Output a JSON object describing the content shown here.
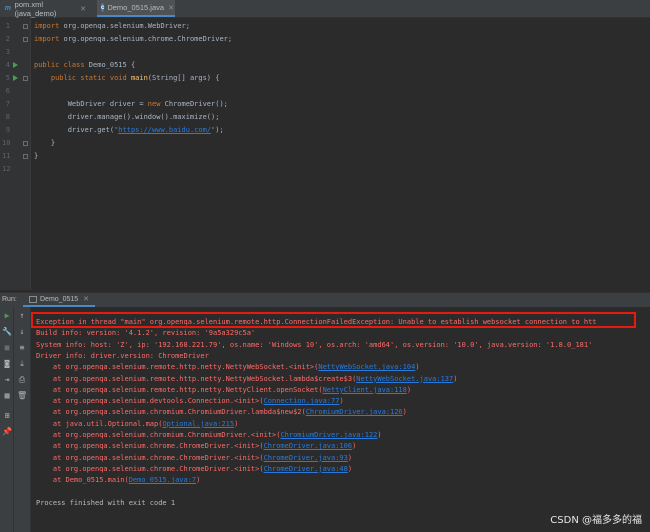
{
  "tabs": [
    {
      "label": "pom.xml (java_demo)",
      "icon": "maven-file-icon",
      "active": false
    },
    {
      "label": "Demo_0515.java",
      "icon": "java-class-icon",
      "active": true
    }
  ],
  "editor": {
    "line_numbers": [
      "1",
      "2",
      "3",
      "4",
      "5",
      "6",
      "7",
      "8",
      "9",
      "10",
      "11",
      "12"
    ],
    "code": [
      {
        "parts": [
          {
            "k": "kw",
            "t": "import "
          },
          {
            "k": "n",
            "t": "org.openqa.selenium.WebDriver;"
          }
        ]
      },
      {
        "parts": [
          {
            "k": "kw",
            "t": "import "
          },
          {
            "k": "n",
            "t": "org.openqa.selenium.chrome.ChromeDriver;"
          }
        ]
      },
      {
        "parts": []
      },
      {
        "parts": [
          {
            "k": "kw",
            "t": "public class "
          },
          {
            "k": "n",
            "t": "Demo_0515 {"
          }
        ]
      },
      {
        "parts": [
          {
            "k": "n",
            "t": "    "
          },
          {
            "k": "kw",
            "t": "public static void "
          },
          {
            "k": "fn",
            "t": "main"
          },
          {
            "k": "n",
            "t": "(String[] args) {"
          }
        ]
      },
      {
        "parts": []
      },
      {
        "parts": [
          {
            "k": "n",
            "t": "        WebDriver driver = "
          },
          {
            "k": "kw",
            "t": "new "
          },
          {
            "k": "n",
            "t": "ChromeDriver();"
          }
        ]
      },
      {
        "parts": [
          {
            "k": "n",
            "t": "        driver.manage().window().maximize();"
          }
        ]
      },
      {
        "parts": [
          {
            "k": "n",
            "t": "        driver.get("
          },
          {
            "k": "str",
            "t": "\""
          },
          {
            "k": "url",
            "t": "https://www.baidu.com/"
          },
          {
            "k": "str",
            "t": "\""
          },
          {
            "k": "n",
            "t": ");"
          }
        ]
      },
      {
        "parts": [
          {
            "k": "n",
            "t": "    }"
          }
        ]
      },
      {
        "parts": [
          {
            "k": "n",
            "t": "}"
          }
        ]
      },
      {
        "parts": []
      }
    ]
  },
  "run_panel": {
    "label": "Run:",
    "tab": "Demo_0515"
  },
  "console": {
    "lines": [
      {
        "style": "err",
        "text": "Exception in thread \"main\" org.openqa.selenium.remote.http.ConnectionFailedException: Unable to establish websocket connection to htt"
      },
      {
        "style": "err",
        "text": "Build info: version: '4.1.2', revision: '9a5a329c5a'"
      },
      {
        "style": "err",
        "text": "System info: host: 'Z', ip: '192.168.221.79', os.name: 'Windows 10', os.arch: 'amd64', os.version: '10.0', java.version: '1.8.0_181'"
      },
      {
        "style": "err",
        "text": "Driver info: driver.version: ChromeDriver"
      },
      {
        "style": "err",
        "text": "    at org.openqa.selenium.remote.http.netty.NettyWebSocket.<init>(",
        "link": "NettyWebSocket.java:104",
        "tail": ")"
      },
      {
        "style": "err",
        "text": "    at org.openqa.selenium.remote.http.netty.NettyWebSocket.lambda$create$3(",
        "link": "NettyWebSocket.java:137",
        "tail": ")"
      },
      {
        "style": "err",
        "text": "    at org.openqa.selenium.remote.http.netty.NettyClient.openSocket(",
        "link": "NettyClient.java:118",
        "tail": ")"
      },
      {
        "style": "err",
        "text": "    at org.openqa.selenium.devtools.Connection.<init>(",
        "link": "Connection.java:77",
        "tail": ")"
      },
      {
        "style": "err",
        "text": "    at org.openqa.selenium.chromium.ChromiumDriver.lambda$new$2(",
        "link": "ChromiumDriver.java:126",
        "tail": ")"
      },
      {
        "style": "err",
        "text": "    at java.util.Optional.map(",
        "link": "Optional.java:215",
        "tail": ")"
      },
      {
        "style": "err",
        "text": "    at org.openqa.selenium.chromium.ChromiumDriver.<init>(",
        "link": "ChromiumDriver.java:122",
        "tail": ")"
      },
      {
        "style": "err",
        "text": "    at org.openqa.selenium.chrome.ChromeDriver.<init>(",
        "link": "ChromeDriver.java:106",
        "tail": ")"
      },
      {
        "style": "err",
        "text": "    at org.openqa.selenium.chrome.ChromeDriver.<init>(",
        "link": "ChromeDriver.java:93",
        "tail": ")"
      },
      {
        "style": "err",
        "text": "    at org.openqa.selenium.chrome.ChromeDriver.<init>(",
        "link": "ChromeDriver.java:48",
        "tail": ")"
      },
      {
        "style": "err",
        "text": "    at Demo_0515.main(",
        "link": "Demo_0515.java:7",
        "tail": ")"
      },
      {
        "style": "plain",
        "text": ""
      },
      {
        "style": "plain",
        "text": "Process finished with exit code 1"
      }
    ]
  },
  "watermark": "CSDN @福多多的福",
  "colors": {
    "error": "#ff6b68",
    "link": "#287bde",
    "highlight_box": "#e8190d",
    "keyword": "#cc7832",
    "string": "#6a8759",
    "method": "#ffc66d"
  }
}
